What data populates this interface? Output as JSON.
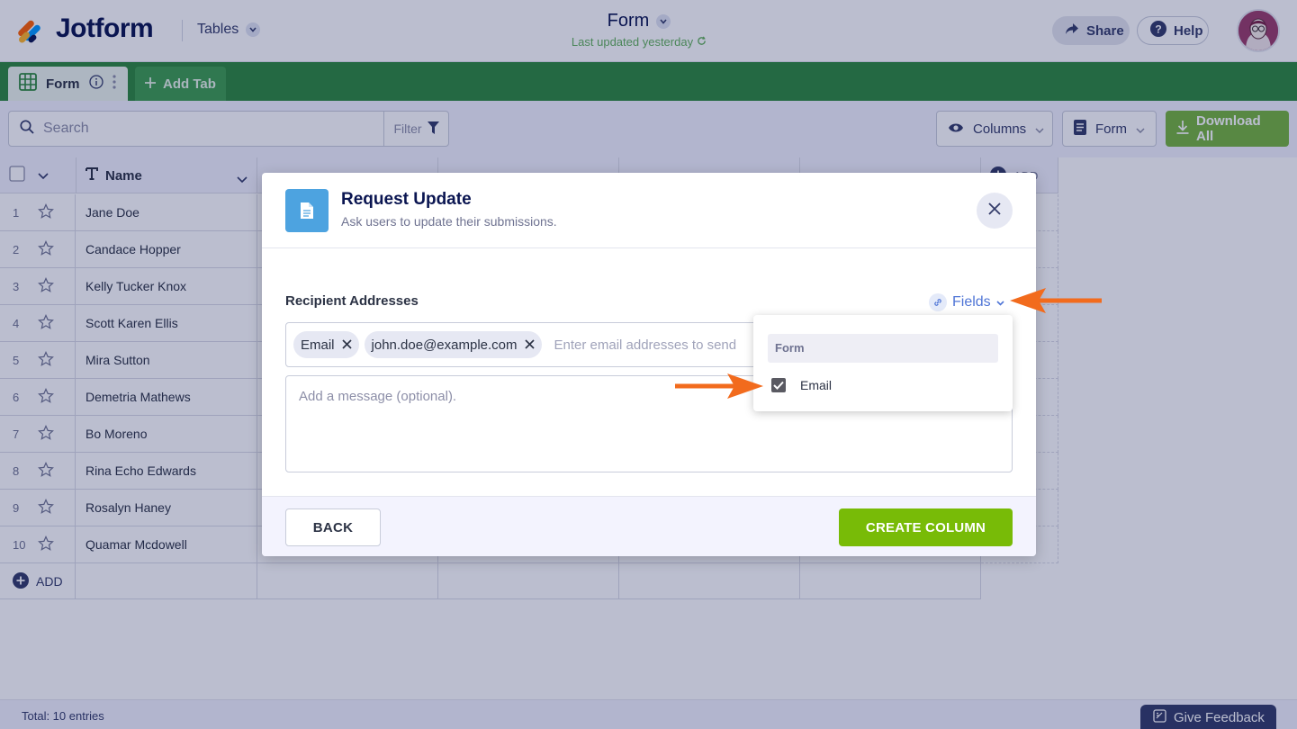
{
  "app": {
    "brand": "Jotform",
    "section_label": "Tables",
    "doc_title": "Form",
    "last_updated": "Last updated yesterday",
    "share_label": "Share",
    "help_label": "Help"
  },
  "tabs": {
    "active_tab_label": "Form",
    "add_tab_label": "Add Tab"
  },
  "toolbar": {
    "search_placeholder": "Search",
    "filter_label": "Filter",
    "columns_label": "Columns",
    "form_label": "Form",
    "download_label": "Download All"
  },
  "table": {
    "name_header": "Name",
    "add_column_label": "ADD",
    "rows": [
      {
        "num": "1",
        "name": "Jane Doe"
      },
      {
        "num": "2",
        "name": "Candace Hopper"
      },
      {
        "num": "3",
        "name": "Kelly Tucker Knox"
      },
      {
        "num": "4",
        "name": "Scott Karen Ellis"
      },
      {
        "num": "5",
        "name": "Mira Sutton"
      },
      {
        "num": "6",
        "name": "Demetria Mathews"
      },
      {
        "num": "7",
        "name": "Bo Moreno"
      },
      {
        "num": "8",
        "name": "Rina Echo Edwards"
      },
      {
        "num": "9",
        "name": "Rosalyn Haney"
      },
      {
        "num": "10",
        "name": "Quamar Mcdowell"
      }
    ],
    "add_row_label": "ADD",
    "total_label": "Total: 10 entries"
  },
  "feedback_label": "Give Feedback",
  "modal": {
    "title": "Request Update",
    "subtitle": "Ask users to update their submissions.",
    "recipient_label": "Recipient Addresses",
    "fields_label": "Fields",
    "chips": [
      "Email",
      "john.doe@example.com"
    ],
    "email_placeholder": "Enter email addresses to send",
    "message_placeholder": "Add a message (optional).",
    "back_label": "BACK",
    "create_label": "CREATE COLUMN"
  },
  "fields_dropdown": {
    "group_label": "Form",
    "item_label": "Email",
    "item_checked": true
  },
  "colors": {
    "brand_navy": "#0a1551",
    "tab_bar_green": "#2e8a3e",
    "create_button_green": "#78bb07",
    "annotation_arrow": "#f26b1d",
    "link_blue": "#4f75d6"
  }
}
